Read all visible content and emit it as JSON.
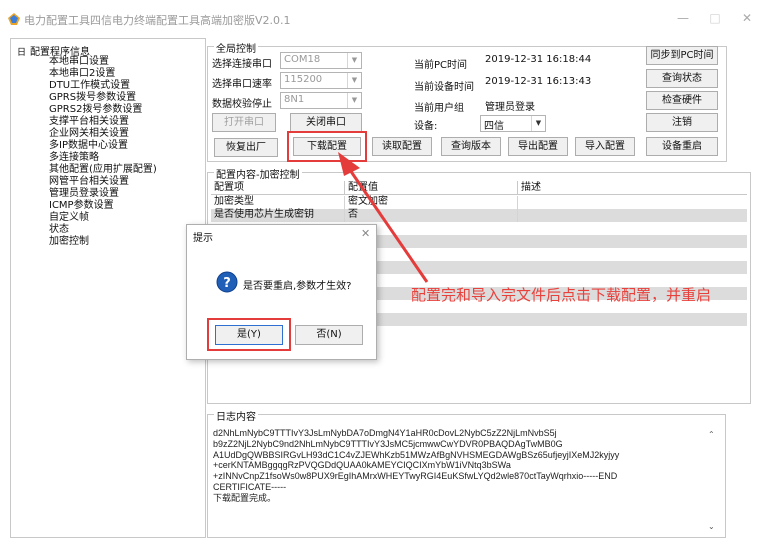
{
  "window": {
    "title": "电力配置工具四信电力终端配置工具高端加密版V2.0.1",
    "minimize_glyph": "—",
    "maximize_glyph": "□",
    "close_glyph": "✕"
  },
  "tree": {
    "root_toggle": "日",
    "root_label": "配置程序信息",
    "items": [
      "本地串口设置",
      "本地串口2设置",
      "DTU工作模式设置",
      "GPRS拨号参数设置",
      "GPRS2拨号参数设置",
      "支撑平台相关设置",
      "企业网关相关设置",
      "多IP数据中心设置",
      "多连接策略",
      "其他配置(应用扩展配置)",
      "网管平台相关设置",
      "管理员登录设置",
      "ICMP参数设置",
      "自定义帧",
      "状态",
      "加密控制"
    ]
  },
  "global_control": {
    "group_label": "全局控制",
    "port_label": "选择连接串口",
    "port_value": "COM18",
    "baud_label": "选择串口速率",
    "baud_value": "115200",
    "parity_label": "数据校验停止",
    "parity_value": "8N1",
    "pc_time_label": "当前PC时间",
    "pc_time_value": "2019-12-31 16:18:44",
    "device_time_label": "当前设备时间",
    "device_time_value": "2019-12-31 16:13:43",
    "user_group_label": "当前用户组",
    "user_group_value": "管理员登录",
    "device_label": "设备:",
    "device_value": "四信",
    "open_port_btn": "打开串口",
    "close_port_btn": "关闭串口",
    "sync_pc_time_btn": "同步到PC时间",
    "query_status_btn": "查询状态",
    "check_hw_btn": "检查硬件",
    "logout_btn": "注销",
    "factory_reset_btn": "恢复出厂",
    "download_config_btn": "下载配置",
    "read_config_btn": "读取配置",
    "query_version_btn": "查询版本",
    "export_config_btn": "导出配置",
    "import_config_btn": "导入配置",
    "device_reboot_btn": "设备重启"
  },
  "config_content": {
    "group_label": "配置内容-加密控制",
    "columns": [
      "配置项",
      "配置值",
      "描述"
    ],
    "rows": [
      {
        "item": "加密类型",
        "value": "密文加密",
        "desc": ""
      },
      {
        "item": "是否使用芯片生成密钥",
        "value": "否",
        "desc": ""
      }
    ]
  },
  "log": {
    "group_label": "日志内容",
    "lines": [
      "d2NhLmNybC9TTTIvY3JsLmNybDA7oDmgN4Y1aHR0cDovL2NybC5zZ2NjLmNvbS5j",
      "b9zZ2NjL2NybC9nd2NhLmNybC9TTTIvY3JsMC5jcmwwCwYDVR0PBAQDAgTwMB0G",
      "A1UdDgQWBBSIRGvLH93dC1C4vZJEWhKzb51MWzAfBgNVHSMEGDAWgBSz65ufjeyjIXeMJ2kyjyy",
      "+cerKNTAMBggqgRzPVQGDdQUAA0kAMEYCIQCIXmYbW1iVNtq3bSWa",
      "+zINNvCnpZ1fsoWs0w8PUX9rEgIhAMrxWHEYTwyRGI4EuKSfwLYQd2wle870ctTayWqrhxio-----END",
      "CERTIFICATE-----",
      "下载配置完成。"
    ]
  },
  "dialog": {
    "title": "提示",
    "close_glyph": "✕",
    "message": "是否要重启,参数才生效?",
    "yes_btn": "是(Y)",
    "no_btn": "否(N)"
  },
  "annotation": {
    "text": "配置完和导入完文件后点击下载配置，并重启"
  },
  "colors": {
    "accent_red": "#e43b3b",
    "annotation_red": "#e8413c",
    "info_icon_blue": "#1f5fb8"
  }
}
